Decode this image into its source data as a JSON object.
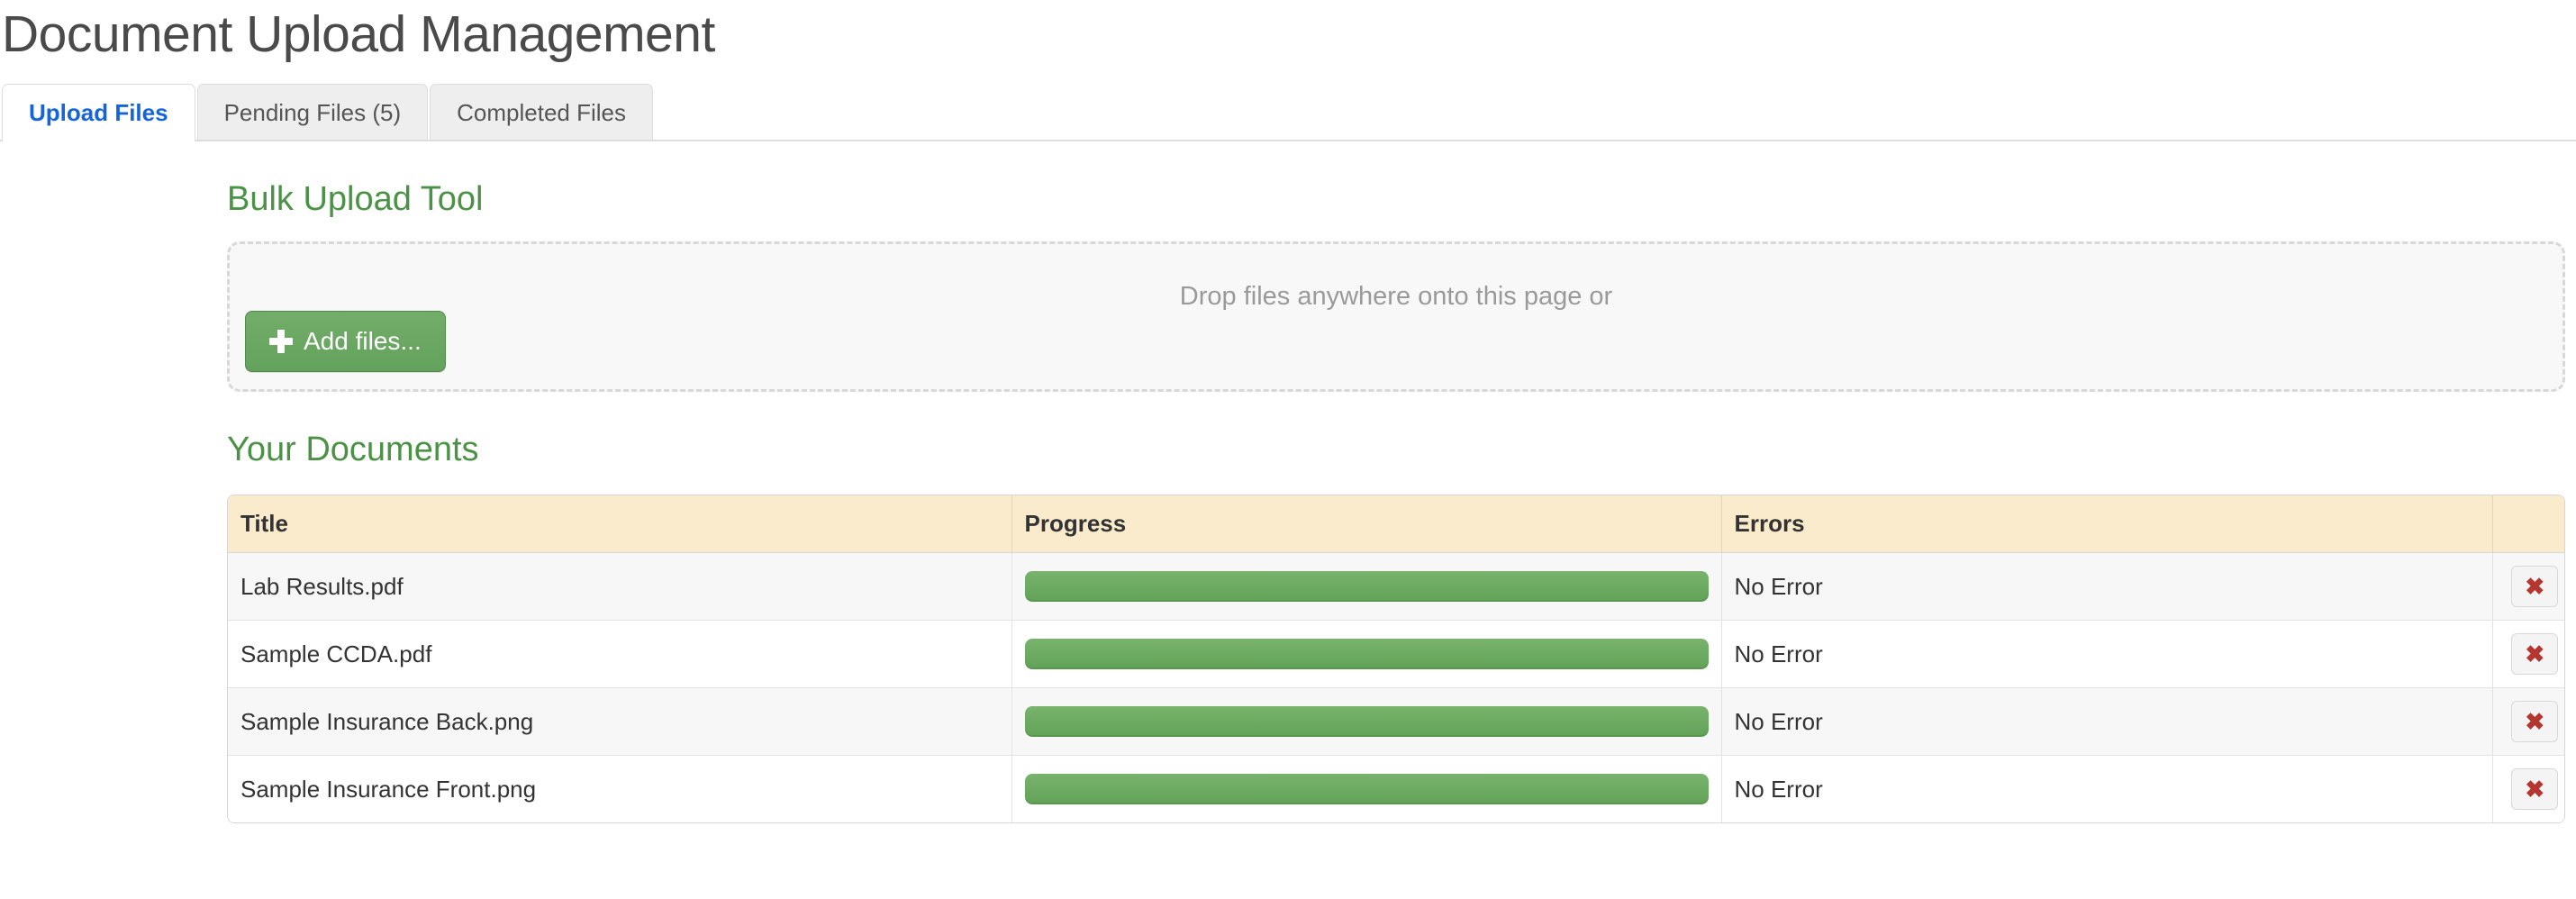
{
  "header": {
    "title": "Document Upload Management"
  },
  "tabs": [
    {
      "label": "Upload Files",
      "active": true
    },
    {
      "label": "Pending Files (5)",
      "active": false
    },
    {
      "label": "Completed Files",
      "active": false
    }
  ],
  "bulk_upload": {
    "heading": "Bulk Upload Tool",
    "dropzone_hint": "Drop files anywhere onto this page or",
    "add_files_label": "Add files...",
    "add_files_icon": "plus-icon"
  },
  "documents": {
    "heading": "Your Documents",
    "columns": [
      "Title",
      "Progress",
      "Errors",
      ""
    ],
    "rows": [
      {
        "title": "Lab Results.pdf",
        "progress": 100,
        "error": "No Error",
        "delete_icon": "✖"
      },
      {
        "title": "Sample CCDA.pdf",
        "progress": 100,
        "error": "No Error",
        "delete_icon": "✖"
      },
      {
        "title": "Sample Insurance Back.png",
        "progress": 100,
        "error": "No Error",
        "delete_icon": "✖"
      },
      {
        "title": "Sample Insurance Front.png",
        "progress": 100,
        "error": "No Error",
        "delete_icon": "✖"
      }
    ]
  },
  "colors": {
    "accent_green": "#4b9246",
    "progress_green": "#6aa84f",
    "tab_active_blue": "#1565d8",
    "table_header_cream": "#faebcd",
    "delete_red": "#b4362f"
  }
}
